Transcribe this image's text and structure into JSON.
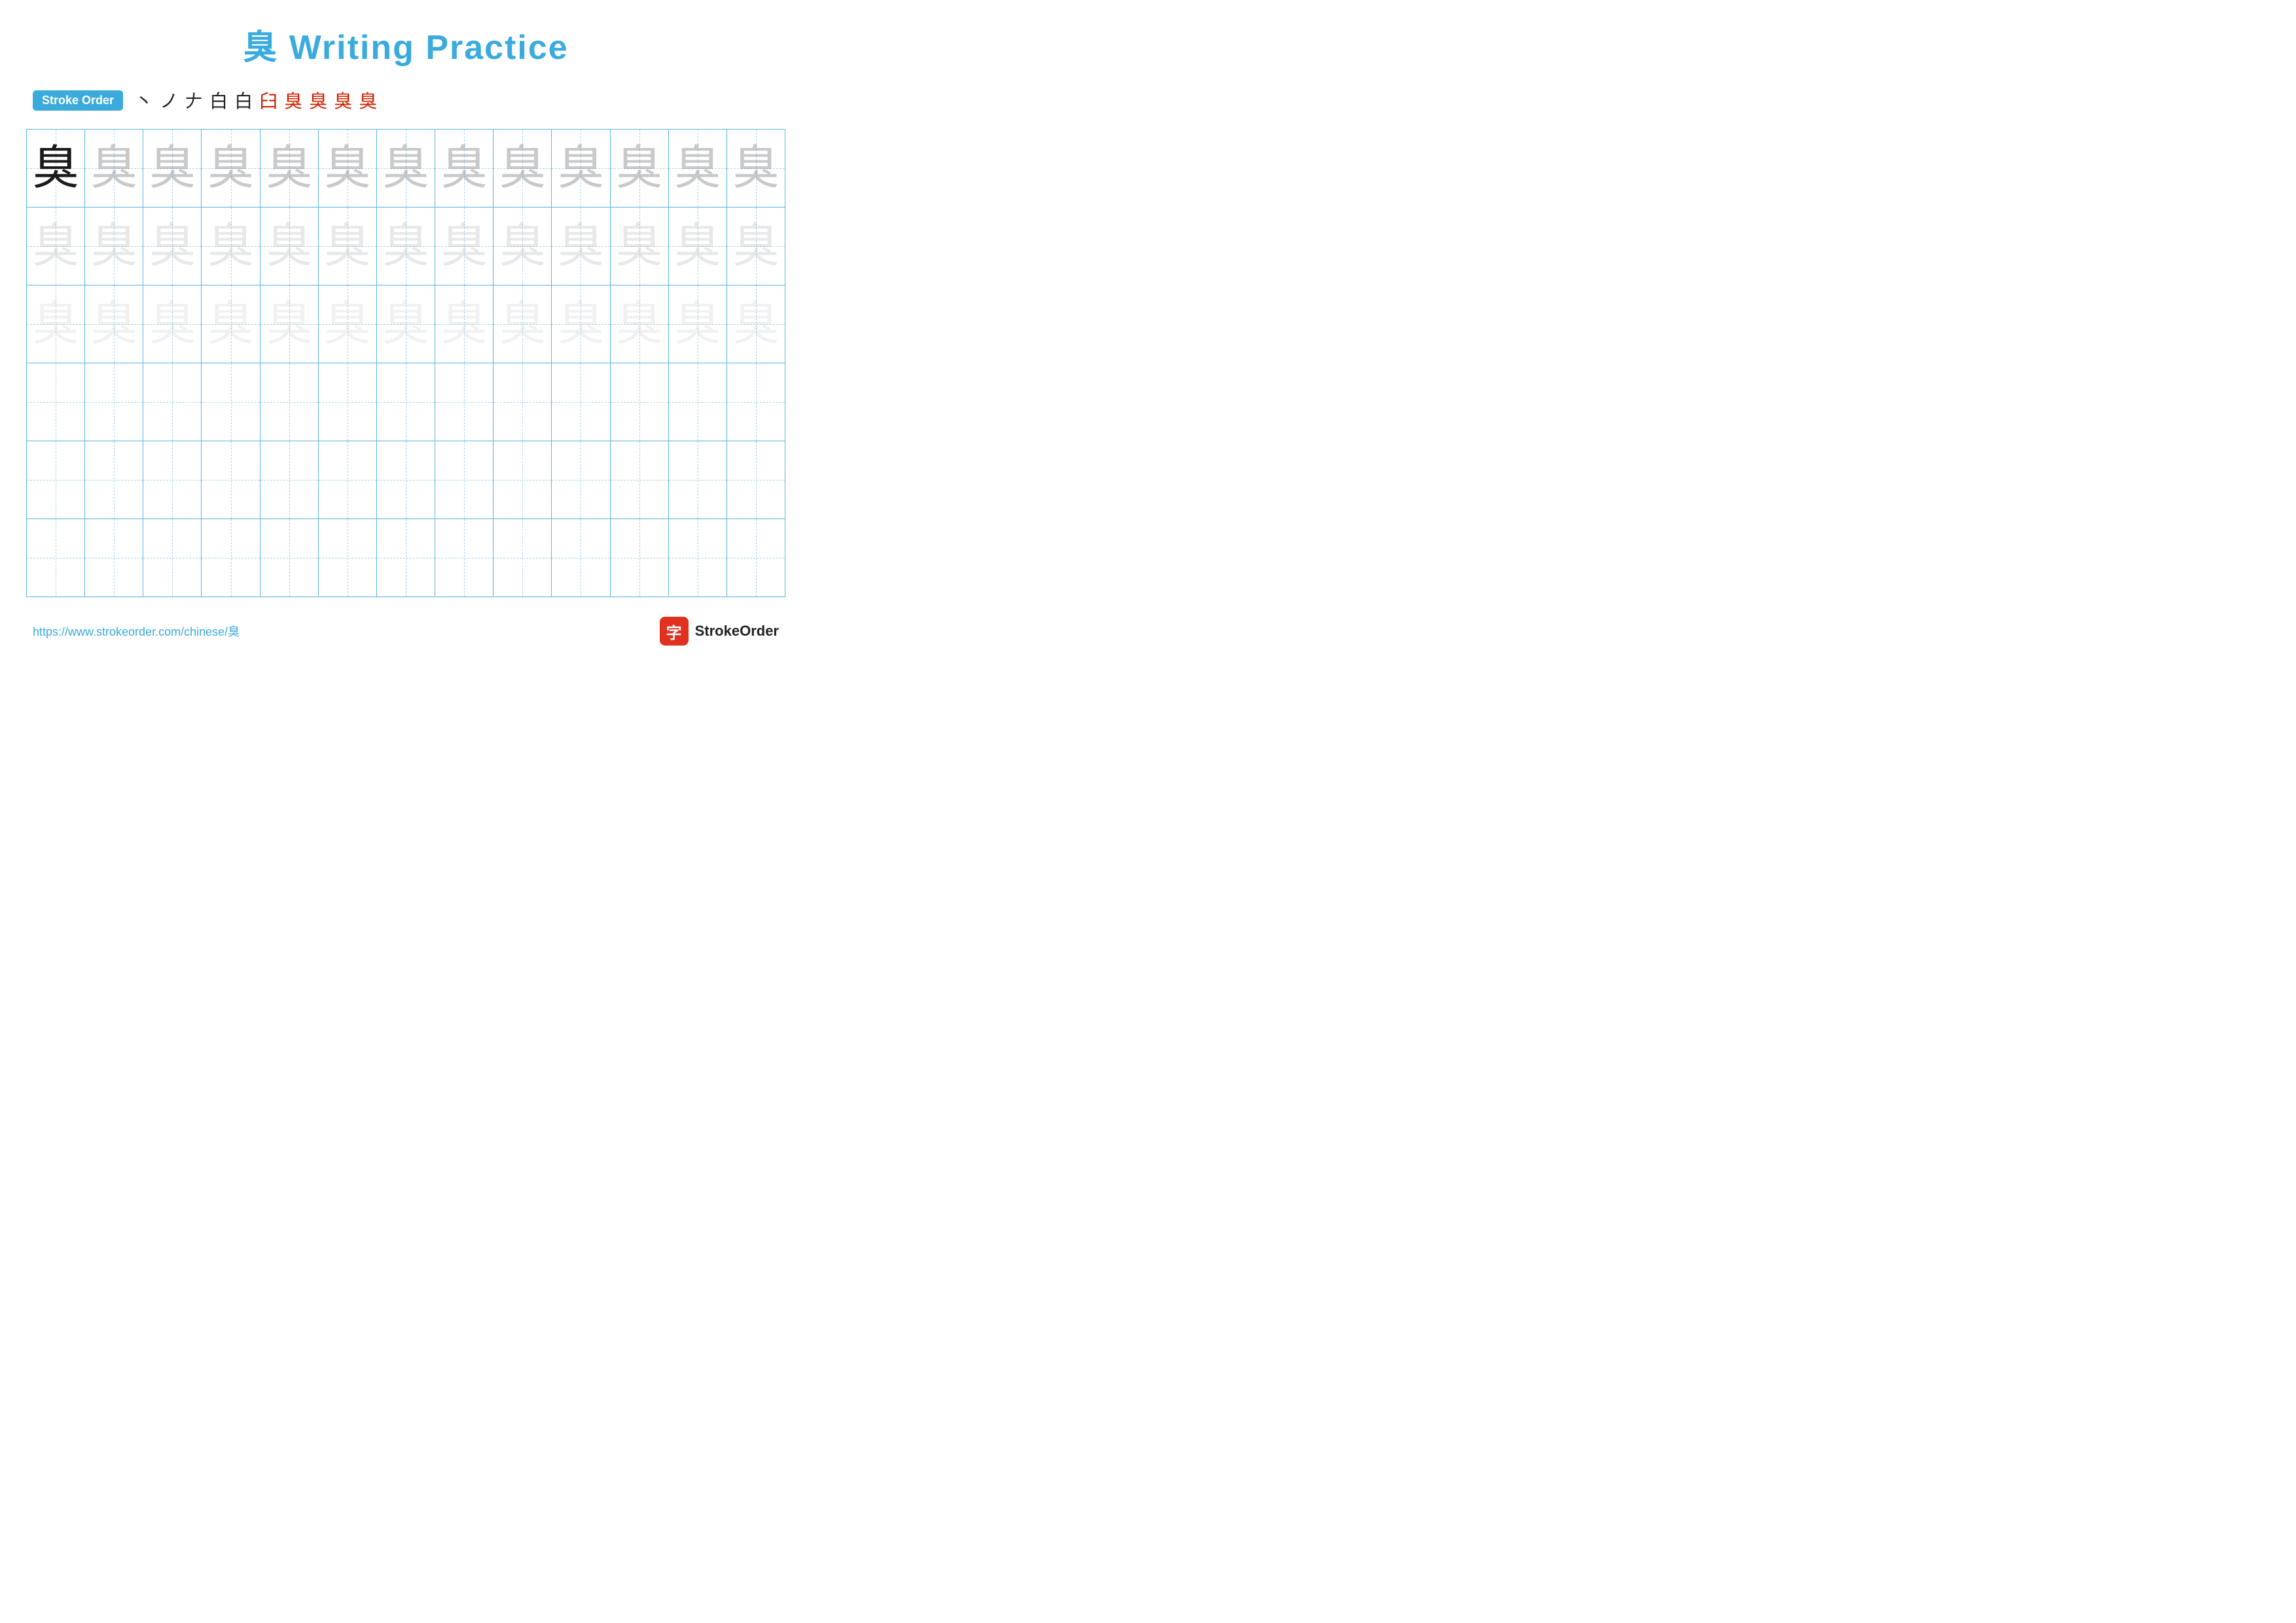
{
  "title": {
    "char": "臭",
    "label": "Writing Practice"
  },
  "stroke_order": {
    "badge": "Stroke Order",
    "strokes_black": [
      "'",
      "𠂆",
      "𠂇",
      "白",
      "白"
    ],
    "strokes_red": [
      "臼",
      "臭",
      "臭",
      "臭",
      "臭"
    ]
  },
  "grid": {
    "cols": 13,
    "rows": 6,
    "char": "臭"
  },
  "footer": {
    "url": "https://www.strokeorder.com/chinese/臭",
    "brand": "StrokeOrder"
  }
}
